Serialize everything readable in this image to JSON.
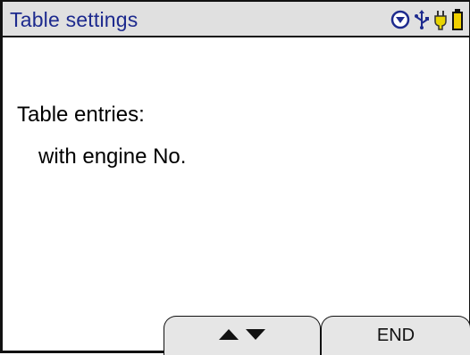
{
  "header": {
    "title": "Table settings",
    "icons": [
      "down-circle-icon",
      "usb-icon",
      "plug-icon",
      "battery-icon"
    ]
  },
  "content": {
    "label": "Table entries:",
    "value": "with engine No."
  },
  "softkeys": {
    "nav": {
      "icon_up": "triangle-up-icon",
      "icon_down": "triangle-down-icon"
    },
    "end_label": "END"
  },
  "colors": {
    "title_text": "#1d2a8e",
    "titlebar_bg": "#e0e0e0",
    "plug_yellow": "#e8d400",
    "battery_yellow": "#f0d000",
    "icon_blue": "#1d2a8e"
  }
}
